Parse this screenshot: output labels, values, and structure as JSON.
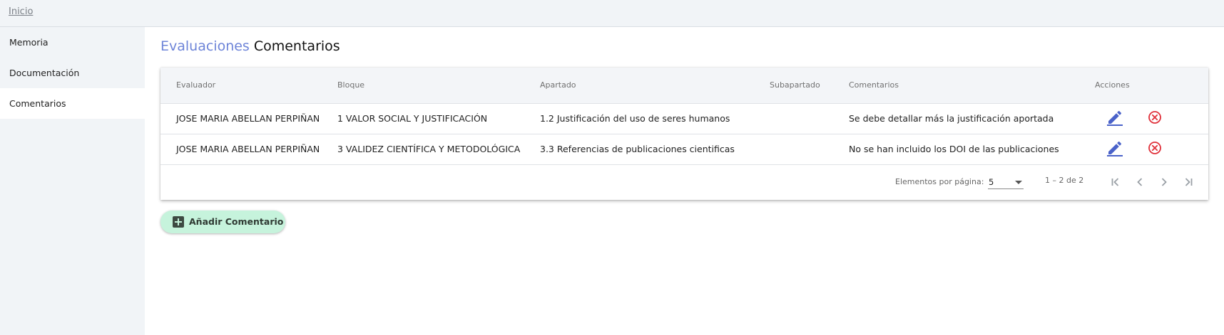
{
  "topbar": {
    "home_link": "Inicio"
  },
  "sidebar": {
    "items": [
      {
        "label": "Memoria",
        "active": false
      },
      {
        "label": "Documentación",
        "active": false
      },
      {
        "label": "Comentarios",
        "active": true
      }
    ]
  },
  "heading": {
    "crumb": "Evaluaciones",
    "current": "Comentarios"
  },
  "table": {
    "columns": [
      "Evaluador",
      "Bloque",
      "Apartado",
      "Subapartado",
      "Comentarios",
      "Acciones"
    ],
    "rows": [
      {
        "evaluador": "JOSE MARIA ABELLAN PERPIÑAN",
        "bloque": "1 VALOR SOCIAL Y JUSTIFICACIÓN",
        "apartado": "1.2 Justificación del uso de seres humanos",
        "subapartado": "",
        "comentario": "Se debe detallar más la justificación aportada"
      },
      {
        "evaluador": "JOSE MARIA ABELLAN PERPIÑAN",
        "bloque": "3 VALIDEZ CIENTÍFICA Y METODOLÓGICA",
        "apartado": "3.3 Referencias de publicaciones cientificas",
        "subapartado": "",
        "comentario": "No se han incluido los DOI de las publicaciones"
      }
    ],
    "action_icons": [
      "edit-icon",
      "delete-icon"
    ]
  },
  "paginator": {
    "label": "Elementos por página:",
    "page_size": "5",
    "range": "1 – 2 de 2"
  },
  "add_button": {
    "label": "Añadir Comentario"
  },
  "colors": {
    "accent": "#6d84d8",
    "edit_icon": "#4a62c9",
    "delete_icon": "#e0303a",
    "add_button_bg": "#c6f3dc",
    "sidebar_bg": "#f1f4f7"
  }
}
